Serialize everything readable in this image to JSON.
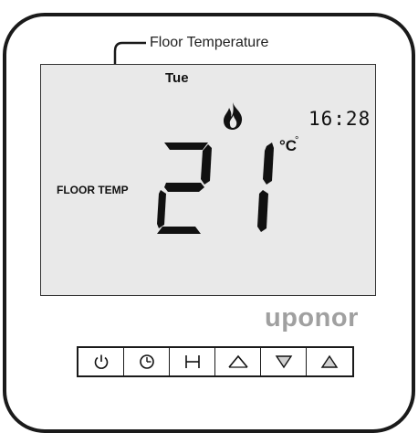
{
  "callout": {
    "label": "Floor Temperature"
  },
  "display": {
    "day": "Tue",
    "time": "16:28",
    "mode_label": "FLOOR TEMP",
    "temperature": "21",
    "unit": "°C",
    "unit_marker": "°",
    "heating_icon": "flame-icon"
  },
  "brand": {
    "name": "uponor",
    "color": "#a0a0a0"
  },
  "buttons": [
    {
      "name": "power",
      "icon": "power-icon"
    },
    {
      "name": "schedule",
      "icon": "clock-icon"
    },
    {
      "name": "hold",
      "icon": "H"
    },
    {
      "name": "up-outline",
      "icon": "caret-up-icon"
    },
    {
      "name": "down",
      "icon": "triangle-down-icon"
    },
    {
      "name": "up",
      "icon": "triangle-up-icon"
    }
  ]
}
